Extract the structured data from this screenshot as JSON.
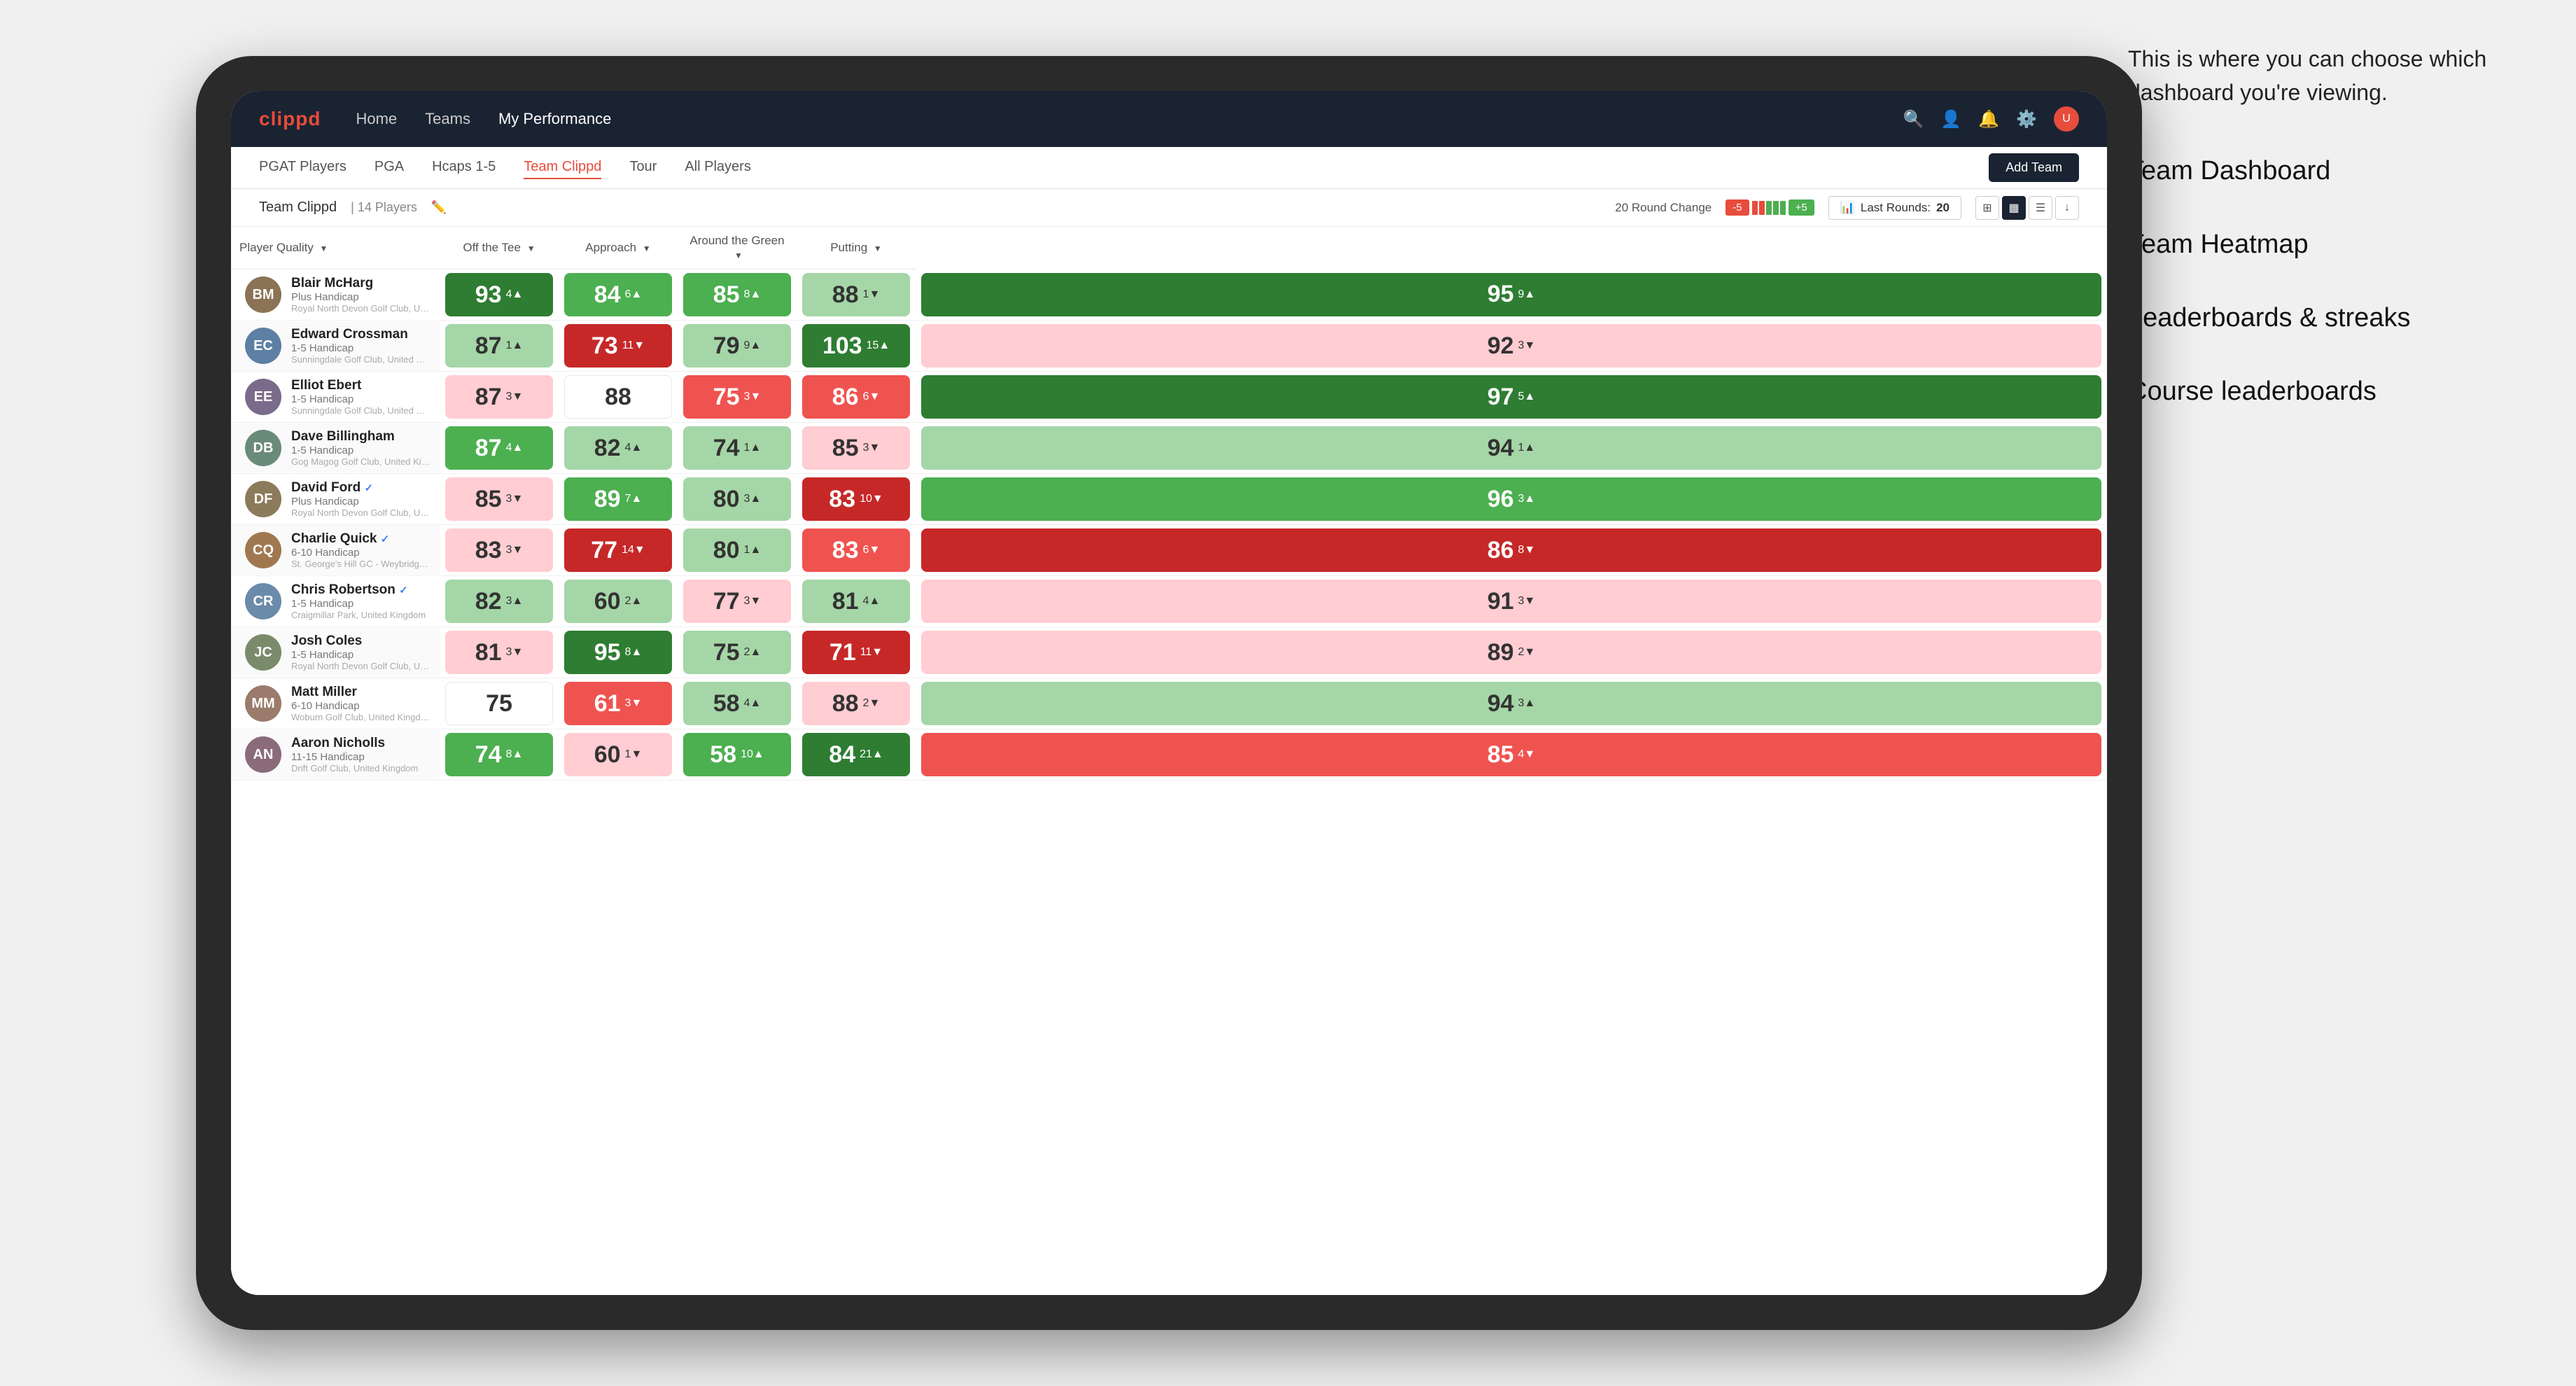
{
  "annotation": {
    "intro_text": "This is where you can choose which dashboard you're viewing.",
    "list_items": [
      "Team Dashboard",
      "Team Heatmap",
      "Leaderboards & streaks",
      "Course leaderboards"
    ]
  },
  "nav": {
    "logo": "clippd",
    "links": [
      "Home",
      "Teams",
      "My Performance"
    ],
    "active_link": "My Performance"
  },
  "sub_nav": {
    "links": [
      "PGAT Players",
      "PGA",
      "Hcaps 1-5",
      "Team Clippd",
      "Tour",
      "All Players"
    ],
    "active_link": "Team Clippd",
    "add_button": "Add Team"
  },
  "team_header": {
    "team_name": "Team Clippd",
    "player_count": "14 Players",
    "round_change_label": "20 Round Change",
    "change_neg": "-5",
    "change_pos": "+5",
    "last_rounds_label": "Last Rounds:",
    "last_rounds_value": "20"
  },
  "table": {
    "columns": [
      {
        "label": "Player Quality",
        "key": "player_quality",
        "has_arrow": true
      },
      {
        "label": "Off the Tee",
        "key": "off_tee",
        "has_arrow": true
      },
      {
        "label": "Approach",
        "key": "approach",
        "has_arrow": true
      },
      {
        "label": "Around the Green",
        "key": "around_green",
        "has_arrow": true
      },
      {
        "label": "Putting",
        "key": "putting",
        "has_arrow": true
      }
    ],
    "rows": [
      {
        "name": "Blair McHarg",
        "handicap": "Plus Handicap",
        "club": "Royal North Devon Golf Club, United Kingdom",
        "verified": false,
        "avatar_color": "#8B7355",
        "player_quality": {
          "value": 93,
          "change": 4,
          "dir": "up",
          "color": "bg-green-dark"
        },
        "off_tee": {
          "value": 84,
          "change": 6,
          "dir": "up",
          "color": "bg-green-mid"
        },
        "approach": {
          "value": 85,
          "change": 8,
          "dir": "up",
          "color": "bg-green-mid"
        },
        "around_green": {
          "value": 88,
          "change": 1,
          "dir": "down",
          "color": "bg-green-light"
        },
        "putting": {
          "value": 95,
          "change": 9,
          "dir": "up",
          "color": "bg-green-dark"
        }
      },
      {
        "name": "Edward Crossman",
        "handicap": "1-5 Handicap",
        "club": "Sunningdale Golf Club, United Kingdom",
        "verified": false,
        "avatar_color": "#5D7FA3",
        "player_quality": {
          "value": 87,
          "change": 1,
          "dir": "up",
          "color": "bg-green-light"
        },
        "off_tee": {
          "value": 73,
          "change": 11,
          "dir": "down",
          "color": "bg-red-dark"
        },
        "approach": {
          "value": 79,
          "change": 9,
          "dir": "up",
          "color": "bg-green-light"
        },
        "around_green": {
          "value": 103,
          "change": 15,
          "dir": "up",
          "color": "bg-green-dark"
        },
        "putting": {
          "value": 92,
          "change": 3,
          "dir": "down",
          "color": "bg-red-light"
        }
      },
      {
        "name": "Elliot Ebert",
        "handicap": "1-5 Handicap",
        "club": "Sunningdale Golf Club, United Kingdom",
        "verified": false,
        "avatar_color": "#7B6B8B",
        "player_quality": {
          "value": 87,
          "change": 3,
          "dir": "down",
          "color": "bg-red-light"
        },
        "off_tee": {
          "value": 88,
          "change": 0,
          "dir": null,
          "color": "bg-white"
        },
        "approach": {
          "value": 75,
          "change": 3,
          "dir": "down",
          "color": "bg-red-mid"
        },
        "around_green": {
          "value": 86,
          "change": 6,
          "dir": "down",
          "color": "bg-red-mid"
        },
        "putting": {
          "value": 97,
          "change": 5,
          "dir": "up",
          "color": "bg-green-dark"
        }
      },
      {
        "name": "Dave Billingham",
        "handicap": "1-5 Handicap",
        "club": "Gog Magog Golf Club, United Kingdom",
        "verified": false,
        "avatar_color": "#6B8B7A",
        "player_quality": {
          "value": 87,
          "change": 4,
          "dir": "up",
          "color": "bg-green-mid"
        },
        "off_tee": {
          "value": 82,
          "change": 4,
          "dir": "up",
          "color": "bg-green-light"
        },
        "approach": {
          "value": 74,
          "change": 1,
          "dir": "up",
          "color": "bg-green-light"
        },
        "around_green": {
          "value": 85,
          "change": 3,
          "dir": "down",
          "color": "bg-red-light"
        },
        "putting": {
          "value": 94,
          "change": 1,
          "dir": "up",
          "color": "bg-green-light"
        }
      },
      {
        "name": "David Ford",
        "handicap": "Plus Handicap",
        "club": "Royal North Devon Golf Club, United Kingdom",
        "verified": true,
        "avatar_color": "#8B7B5A",
        "player_quality": {
          "value": 85,
          "change": 3,
          "dir": "down",
          "color": "bg-red-light"
        },
        "off_tee": {
          "value": 89,
          "change": 7,
          "dir": "up",
          "color": "bg-green-mid"
        },
        "approach": {
          "value": 80,
          "change": 3,
          "dir": "up",
          "color": "bg-green-light"
        },
        "around_green": {
          "value": 83,
          "change": 10,
          "dir": "down",
          "color": "bg-red-dark"
        },
        "putting": {
          "value": 96,
          "change": 3,
          "dir": "up",
          "color": "bg-green-mid"
        }
      },
      {
        "name": "Charlie Quick",
        "handicap": "6-10 Handicap",
        "club": "St. George's Hill GC - Weybridge · Surrey, Uni...",
        "verified": true,
        "avatar_color": "#A07850",
        "player_quality": {
          "value": 83,
          "change": 3,
          "dir": "down",
          "color": "bg-red-light"
        },
        "off_tee": {
          "value": 77,
          "change": 14,
          "dir": "down",
          "color": "bg-red-dark"
        },
        "approach": {
          "value": 80,
          "change": 1,
          "dir": "up",
          "color": "bg-green-light"
        },
        "around_green": {
          "value": 83,
          "change": 6,
          "dir": "down",
          "color": "bg-red-mid"
        },
        "putting": {
          "value": 86,
          "change": 8,
          "dir": "down",
          "color": "bg-red-dark"
        }
      },
      {
        "name": "Chris Robertson",
        "handicap": "1-5 Handicap",
        "club": "Craigmillar Park, United Kingdom",
        "verified": true,
        "avatar_color": "#6B8BAA",
        "player_quality": {
          "value": 82,
          "change": 3,
          "dir": "up",
          "color": "bg-green-light"
        },
        "off_tee": {
          "value": 60,
          "change": 2,
          "dir": "up",
          "color": "bg-green-light"
        },
        "approach": {
          "value": 77,
          "change": 3,
          "dir": "down",
          "color": "bg-red-light"
        },
        "around_green": {
          "value": 81,
          "change": 4,
          "dir": "up",
          "color": "bg-green-light"
        },
        "putting": {
          "value": 91,
          "change": 3,
          "dir": "down",
          "color": "bg-red-light"
        }
      },
      {
        "name": "Josh Coles",
        "handicap": "1-5 Handicap",
        "club": "Royal North Devon Golf Club, United Kingdom",
        "verified": false,
        "avatar_color": "#7A8B6B",
        "player_quality": {
          "value": 81,
          "change": 3,
          "dir": "down",
          "color": "bg-red-light"
        },
        "off_tee": {
          "value": 95,
          "change": 8,
          "dir": "up",
          "color": "bg-green-dark"
        },
        "approach": {
          "value": 75,
          "change": 2,
          "dir": "up",
          "color": "bg-green-light"
        },
        "around_green": {
          "value": 71,
          "change": 11,
          "dir": "down",
          "color": "bg-red-dark"
        },
        "putting": {
          "value": 89,
          "change": 2,
          "dir": "down",
          "color": "bg-red-light"
        }
      },
      {
        "name": "Matt Miller",
        "handicap": "6-10 Handicap",
        "club": "Woburn Golf Club, United Kingdom",
        "verified": false,
        "avatar_color": "#9B7B6B",
        "player_quality": {
          "value": 75,
          "change": 0,
          "dir": null,
          "color": "bg-white"
        },
        "off_tee": {
          "value": 61,
          "change": 3,
          "dir": "down",
          "color": "bg-red-mid"
        },
        "approach": {
          "value": 58,
          "change": 4,
          "dir": "up",
          "color": "bg-green-light"
        },
        "around_green": {
          "value": 88,
          "change": 2,
          "dir": "down",
          "color": "bg-red-light"
        },
        "putting": {
          "value": 94,
          "change": 3,
          "dir": "up",
          "color": "bg-green-light"
        }
      },
      {
        "name": "Aaron Nicholls",
        "handicap": "11-15 Handicap",
        "club": "Drift Golf Club, United Kingdom",
        "verified": false,
        "avatar_color": "#8B6B7A",
        "player_quality": {
          "value": 74,
          "change": 8,
          "dir": "up",
          "color": "bg-green-mid"
        },
        "off_tee": {
          "value": 60,
          "change": 1,
          "dir": "down",
          "color": "bg-red-light"
        },
        "approach": {
          "value": 58,
          "change": 10,
          "dir": "up",
          "color": "bg-green-mid"
        },
        "around_green": {
          "value": 84,
          "change": 21,
          "dir": "up",
          "color": "bg-green-dark"
        },
        "putting": {
          "value": 85,
          "change": 4,
          "dir": "down",
          "color": "bg-red-mid"
        }
      }
    ]
  }
}
